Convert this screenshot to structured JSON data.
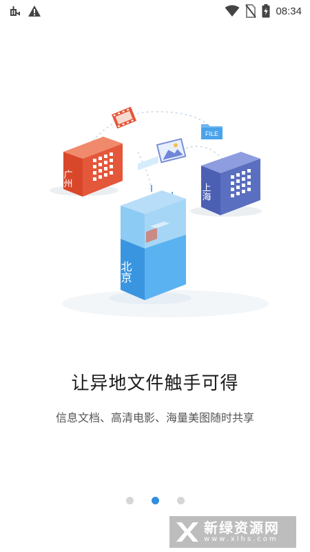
{
  "status_bar": {
    "time": "08:34",
    "icons": [
      "bug-icon",
      "warning-icon",
      "wifi-icon",
      "no-sim-icon",
      "battery-charging-icon"
    ]
  },
  "illustration": {
    "city_guangzhou": "广州",
    "city_shanghai": "上海",
    "city_beijing": "北京",
    "file_badge": "FILE"
  },
  "content": {
    "headline": "让异地文件触手可得",
    "subline": "信息文档、高清电影、海量美图随时共享"
  },
  "pager": {
    "total": 3,
    "active_index": 1
  },
  "watermark": {
    "title": "新绿资源网",
    "url": "www.xlhs.com"
  },
  "colors": {
    "accent": "#2f8ee0",
    "guangzhou": "#e4573a",
    "shanghai": "#5a6fbf",
    "beijing": "#5bb2f0"
  }
}
